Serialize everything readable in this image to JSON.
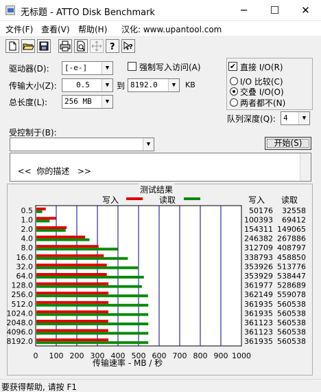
{
  "window": {
    "title": "无标题 - ATTO Disk Benchmark",
    "minimize_label": "─",
    "maximize_label": "☐",
    "close_label": "✕"
  },
  "menu": {
    "file": "文件(F)",
    "view": "查看(V)",
    "help": "帮助(H)",
    "site": "汉化: www.upantool.com"
  },
  "toolbar": {
    "new_icon": "new-file-icon",
    "open_icon": "open-folder-icon",
    "save_icon": "save-disk-icon",
    "print_icon": "printer-icon",
    "preview_icon": "print-preview-icon",
    "move_icon": "move-icon",
    "about_icon": "about-question-icon",
    "context_help_icon": "context-help-icon"
  },
  "settings": {
    "drive_label": "驱动器(D):",
    "drive_value": "[-e-]",
    "force_write_label": "强制写入访问(A)",
    "force_write_checked": false,
    "transfer_label": "传输大小(Z):",
    "transfer_from": "0.5",
    "to_label": "到",
    "transfer_to": "8192.0",
    "unit": "KB",
    "length_label": "总长度(L):",
    "length_value": "256 MB",
    "direct_io_label": "直接 I/O(R)",
    "direct_io_checked": true,
    "radio_io_compare": "I/O 比较(C)",
    "radio_overlapped": "交叠 I/O(O)",
    "radio_neither": "两者都不(N)",
    "selected_radio": "radio_overlapped",
    "queue_label": "队列深度(Q):",
    "queue_value": "4",
    "controlled_label": "受控制于(B):",
    "controlled_value": "",
    "start_button": "开始(S)",
    "description": "<<  你的描述   >>"
  },
  "results": {
    "frame_title": "测试结果",
    "legend_write": "写入",
    "legend_read": "读取",
    "col_write": "写入",
    "col_read": "读取",
    "write_values": [
      "50176",
      "100393",
      "154311",
      "246382",
      "312709",
      "338793",
      "353926",
      "353929",
      "361977",
      "362149",
      "361935",
      "361935",
      "361123",
      "361123",
      "361935"
    ],
    "read_values": [
      "32558",
      "69412",
      "149065",
      "267886",
      "408797",
      "458850",
      "513776",
      "538447",
      "528689",
      "559078",
      "560538",
      "560538",
      "560538",
      "560538",
      "560538"
    ]
  },
  "chart_data": {
    "type": "bar",
    "orientation": "horizontal",
    "categories": [
      "0.5",
      "1.0",
      "2.0",
      "4.0",
      "8.0",
      "16.0",
      "32.0",
      "64.0",
      "128.0",
      "256.0",
      "512.0",
      "1024.0",
      "2048.0",
      "4096.0",
      "8192.0"
    ],
    "series": [
      {
        "name": "写入",
        "values": [
          49.0,
          98.0,
          150.7,
          240.6,
          305.4,
          330.9,
          345.6,
          345.6,
          353.5,
          353.7,
          353.5,
          353.5,
          352.7,
          352.7,
          353.5
        ],
        "color": "#e00000"
      },
      {
        "name": "读取",
        "values": [
          31.8,
          67.8,
          145.6,
          261.6,
          399.2,
          448.1,
          501.7,
          525.8,
          516.3,
          546.0,
          547.4,
          547.4,
          547.4,
          547.4,
          547.4
        ],
        "color": "#0a8a0a"
      }
    ],
    "xlabel": "传输速率 - MB / 秒",
    "xlim": [
      0,
      1000
    ],
    "xticks": [
      "0",
      "100",
      "200",
      "300",
      "400",
      "500",
      "600",
      "700",
      "800",
      "900",
      "1000"
    ],
    "grid": true,
    "grid_color": "#000080"
  },
  "status": {
    "text": "要获得帮助, 请按 F1"
  }
}
